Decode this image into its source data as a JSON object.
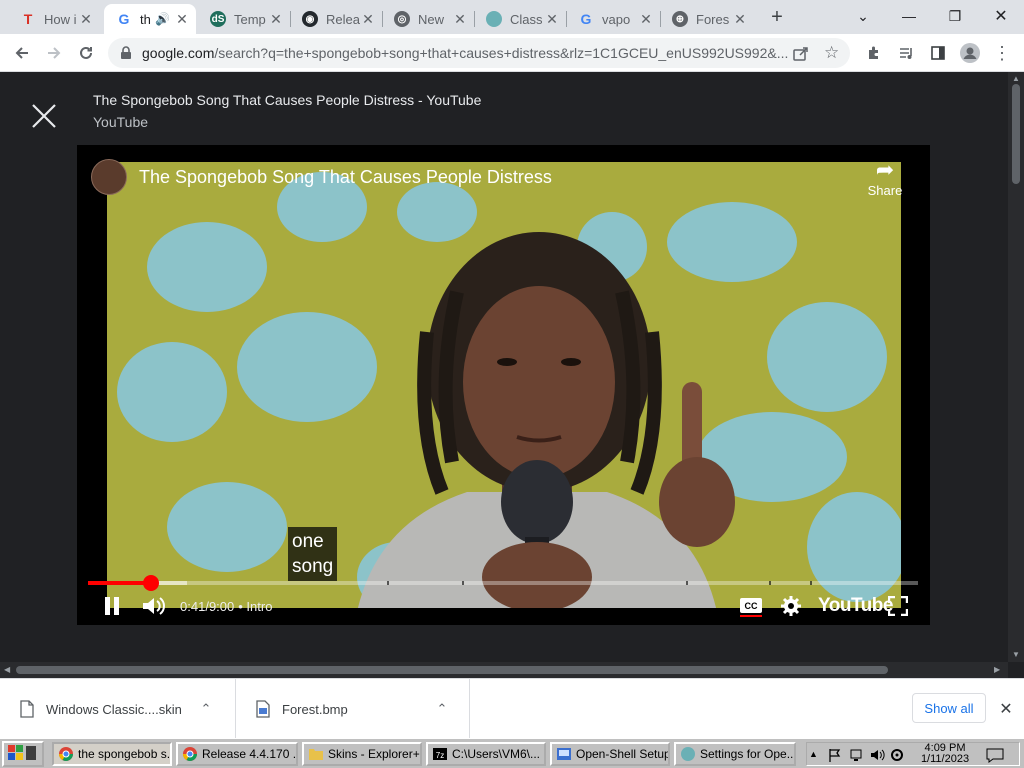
{
  "tabs": [
    {
      "title": "How i",
      "favicon": "T"
    },
    {
      "title": "th",
      "favicon": "G",
      "active": true
    },
    {
      "title": "Temp",
      "favicon": "dS"
    },
    {
      "title": "Relea",
      "favicon": "github"
    },
    {
      "title": "New",
      "favicon": "chrome"
    },
    {
      "title": "Class",
      "favicon": "globe"
    },
    {
      "title": "vapo",
      "favicon": "G"
    },
    {
      "title": "Fores",
      "favicon": "globe"
    }
  ],
  "address": {
    "domain": "google.com",
    "path": "/search?q=the+spongebob+song+that+causes+distress&rlz=1C1GCEU_enUS992US992&..."
  },
  "video": {
    "page_title": "The Spongebob Song That Causes People Distress - YouTube",
    "source": "YouTube",
    "player_title": "The Spongebob Song That Causes People Distress",
    "share_label": "Share",
    "caption_line1": "one",
    "caption_line2": "song",
    "time_current": "0:41",
    "time_separator": " / ",
    "time_total": "9:00",
    "chapter": "• Intro",
    "played_fraction": 0.076,
    "loaded_fraction": 0.119,
    "chapter_marks": [
      0.36,
      0.45,
      0.72,
      0.82,
      0.87
    ],
    "logo": "YouTube"
  },
  "downloads": [
    {
      "name": "Windows Classic....skin"
    },
    {
      "name": "Forest.bmp"
    }
  ],
  "downloads_show_all": "Show all",
  "taskbar": {
    "items": [
      {
        "label": "the spongebob s..."
      },
      {
        "label": "Release 4.4.170 ..."
      },
      {
        "label": "Skins - Explorer++"
      },
      {
        "label": "C:\\Users\\VM6\\..."
      },
      {
        "label": "Open-Shell Setup"
      },
      {
        "label": "Settings for Ope..."
      }
    ],
    "time": "4:09 PM",
    "date": "1/11/2023"
  },
  "colors": {
    "accent_red": "#ff0000",
    "link_blue": "#1a73e8",
    "overlay_bg": "#202124"
  }
}
